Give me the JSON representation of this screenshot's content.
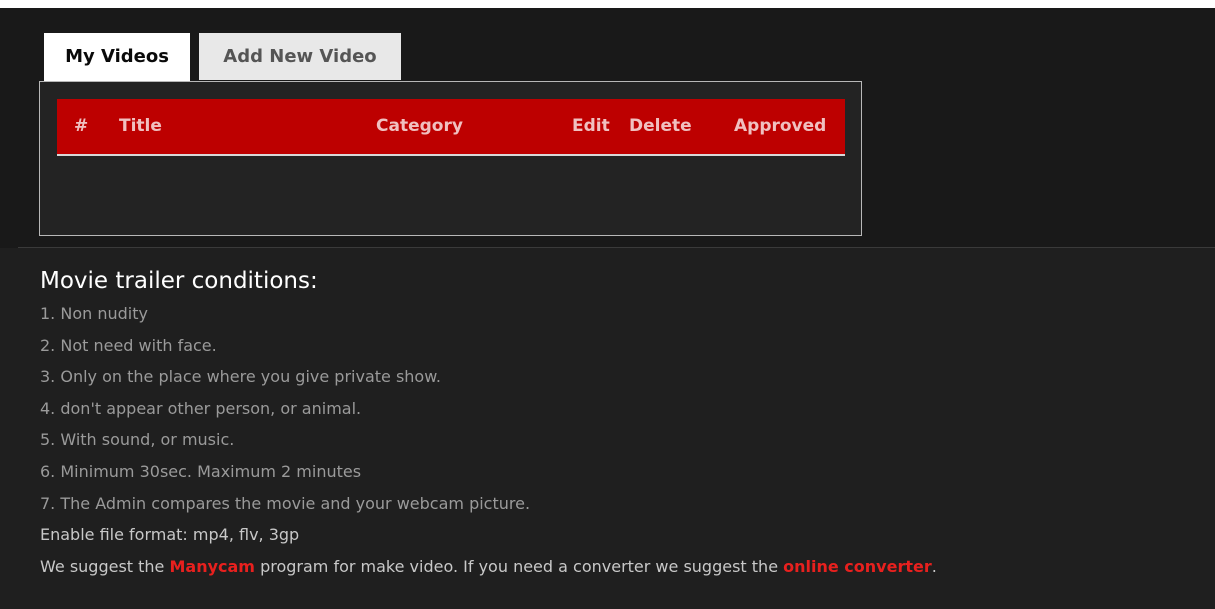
{
  "tabs": {
    "my_videos": "My Videos",
    "add_new_video": "Add New Video"
  },
  "table": {
    "headers": {
      "num": "#",
      "title": "Title",
      "category": "Category",
      "edit": "Edit",
      "delete": "Delete",
      "approved": "Approved"
    },
    "rows": []
  },
  "conditions": {
    "title": "Movie trailer conditions:",
    "items": [
      "1. Non nudity",
      "2. Not need with face.",
      "3. Only on the place where you give private show.",
      "4. don't appear other person, or animal.",
      "5. With sound, or music.",
      "6. Minimum 30sec. Maximum 2 minutes",
      "7. The Admin compares the movie and your webcam picture."
    ],
    "formats": "Enable file format: mp4, flv, 3gp",
    "suggest_prefix": "We suggest the ",
    "manycam_link": "Manycam",
    "suggest_middle": " program for make video.  If you need a converter we suggest the ",
    "converter_link": "online converter",
    "suggest_suffix": "."
  },
  "colors": {
    "background": "#1f1f1f",
    "header_red": "#bd0000",
    "link_red": "#e8201e"
  }
}
